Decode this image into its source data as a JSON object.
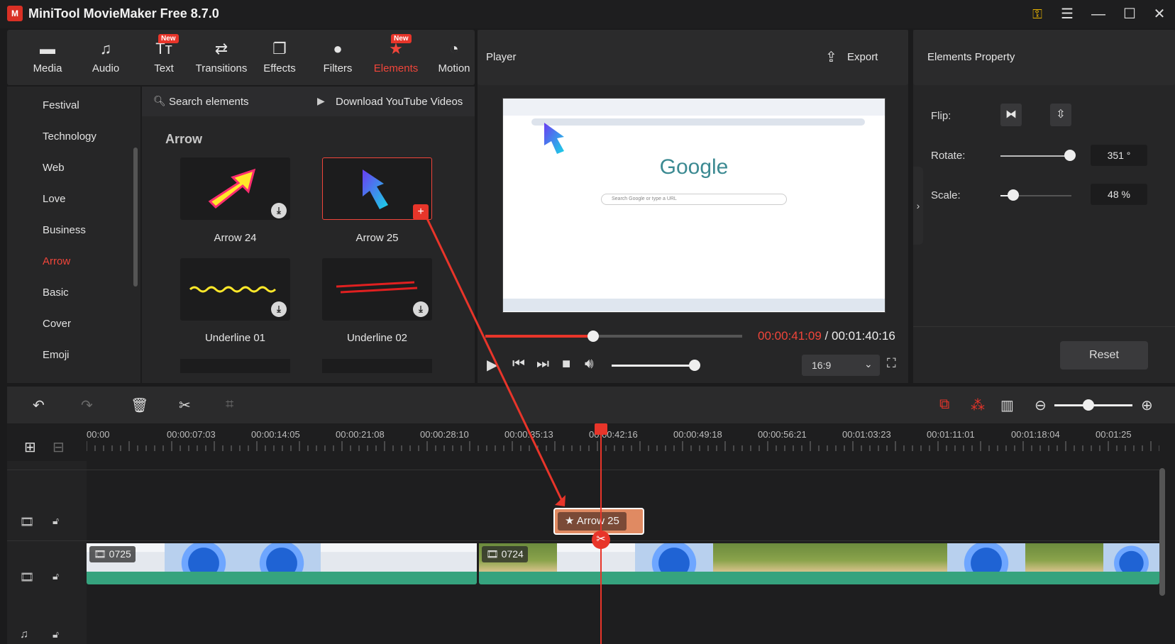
{
  "app": {
    "title": "MiniTool MovieMaker Free 8.7.0",
    "logo": "M"
  },
  "window_controls": {
    "key_icon": "key-icon",
    "menu_icon": "menu-icon",
    "min": "—",
    "max": "☐",
    "close": "✕"
  },
  "toolbar": {
    "items": [
      {
        "label": "Media",
        "icon": "▬"
      },
      {
        "label": "Audio",
        "icon": "♫"
      },
      {
        "label": "Text",
        "icon": "Tт",
        "badge": "New"
      },
      {
        "label": "Transitions",
        "icon": "⇄"
      },
      {
        "label": "Effects",
        "icon": "❐"
      },
      {
        "label": "Filters",
        "icon": "●"
      },
      {
        "label": "Elements",
        "icon": "★",
        "badge": "New"
      },
      {
        "label": "Motion",
        "icon": "◔"
      }
    ],
    "active": "Elements"
  },
  "categories": [
    "Festival",
    "Technology",
    "Web",
    "Love",
    "Business",
    "Arrow",
    "Basic",
    "Cover",
    "Emoji"
  ],
  "active_category": "Arrow",
  "search": {
    "placeholder": "Search elements",
    "download_link": "Download YouTube Videos"
  },
  "section_title": "Arrow",
  "elements": [
    {
      "label": "Arrow 24"
    },
    {
      "label": "Arrow 25"
    },
    {
      "label": "Underline 01"
    },
    {
      "label": "Underline 02"
    }
  ],
  "player": {
    "title": "Player",
    "export_label": "Export",
    "current_time": "00:00:41:09",
    "separator": " / ",
    "total_time": "00:01:40:16",
    "progress": 0.41,
    "volume": 0.8,
    "aspect": "16:9",
    "preview": {
      "google_logo": "Google",
      "search_placeholder": "Search Google or type a URL"
    }
  },
  "properties": {
    "title": "Elements Property",
    "flip_label": "Flip:",
    "rotate_label": "Rotate:",
    "rotate_value": "351 °",
    "rotate_fraction": 0.975,
    "scale_label": "Scale:",
    "scale_value": "48 %",
    "scale_fraction": 0.18,
    "reset_label": "Reset"
  },
  "timeline": {
    "ticks": [
      "00:00",
      "00:00:07:03",
      "00:00:14:05",
      "00:00:21:08",
      "00:00:28:10",
      "00:00:35:13",
      "00:00:42:16",
      "00:00:49:18",
      "00:00:56:21",
      "00:01:03:23",
      "00:01:11:01",
      "00:01:18:04",
      "00:01:25"
    ],
    "element_clip": "Arrow 25",
    "video_clips": [
      {
        "label": "0725"
      },
      {
        "label": "0724"
      }
    ],
    "zoom": 0.45
  }
}
